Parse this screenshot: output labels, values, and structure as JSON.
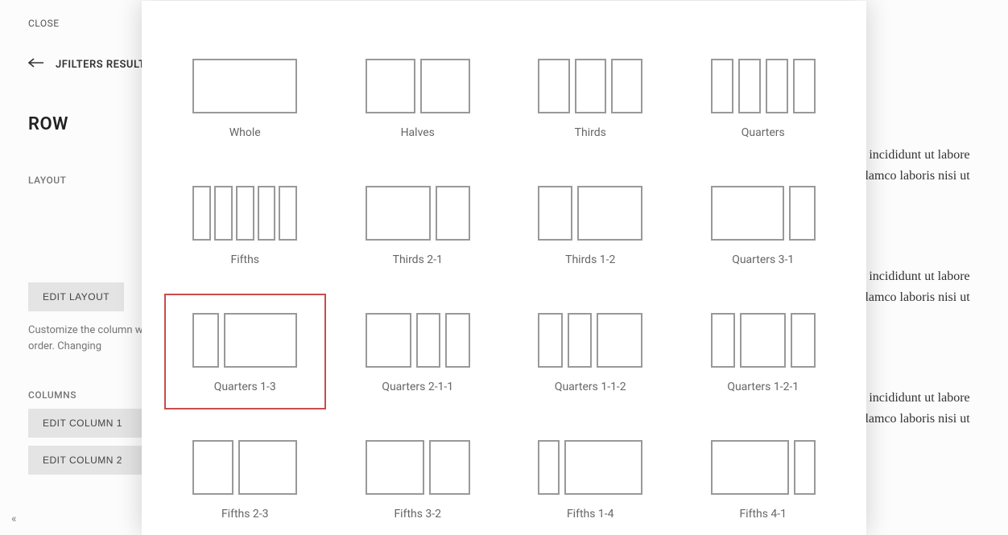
{
  "sidebar": {
    "close_label": "CLOSE",
    "back_label": "JFILTERS RESULTS",
    "row_heading": "ROW",
    "layout_heading": "LAYOUT",
    "edit_layout_label": "EDIT LAYOUT",
    "help_text": "Customize the column widths of this row, and the column order. Changing",
    "columns_heading": "COLUMNS",
    "edit_col1_label": "EDIT COLUMN 1",
    "edit_col2_label": "EDIT COLUMN 2",
    "collapse_glyph": "«"
  },
  "content": {
    "para1_a": "r incididunt ut labore",
    "para1_b": "llamco laboris nisi ut",
    "para2_a": "r incididunt ut labore",
    "para2_b": "llamco laboris nisi ut",
    "para3_a": "r incididunt ut labore",
    "para3_b": "llamco laboris nisi ut"
  },
  "modal": {
    "selected": "quarters-1-3",
    "options": [
      {
        "id": "whole",
        "label": "Whole",
        "cols": [
          1
        ]
      },
      {
        "id": "halves",
        "label": "Halves",
        "cols": [
          1,
          1
        ]
      },
      {
        "id": "thirds",
        "label": "Thirds",
        "cols": [
          1,
          1,
          1
        ]
      },
      {
        "id": "quarters",
        "label": "Quarters",
        "cols": [
          1,
          1,
          1,
          1
        ]
      },
      {
        "id": "fifths",
        "label": "Fifths",
        "cols": [
          1,
          1,
          1,
          1,
          1
        ]
      },
      {
        "id": "thirds-2-1",
        "label": "Thirds 2-1",
        "cols": [
          2,
          1
        ]
      },
      {
        "id": "thirds-1-2",
        "label": "Thirds 1-2",
        "cols": [
          1,
          2
        ]
      },
      {
        "id": "quarters-3-1",
        "label": "Quarters 3-1",
        "cols": [
          3,
          1
        ]
      },
      {
        "id": "quarters-1-3",
        "label": "Quarters 1-3",
        "cols": [
          1,
          3
        ]
      },
      {
        "id": "quarters-2-1-1",
        "label": "Quarters 2-1-1",
        "cols": [
          2,
          1,
          1
        ]
      },
      {
        "id": "quarters-1-1-2",
        "label": "Quarters 1-1-2",
        "cols": [
          1,
          1,
          2
        ]
      },
      {
        "id": "quarters-1-2-1",
        "label": "Quarters 1-2-1",
        "cols": [
          1,
          2,
          1
        ]
      },
      {
        "id": "fifths-2-3",
        "label": "Fifths 2-3",
        "cols": [
          2,
          3
        ]
      },
      {
        "id": "fifths-3-2",
        "label": "Fifths 3-2",
        "cols": [
          3,
          2
        ]
      },
      {
        "id": "fifths-1-4",
        "label": "Fifths 1-4",
        "cols": [
          1,
          4
        ]
      },
      {
        "id": "fifths-4-1",
        "label": "Fifths 4-1",
        "cols": [
          4,
          1
        ]
      }
    ]
  }
}
